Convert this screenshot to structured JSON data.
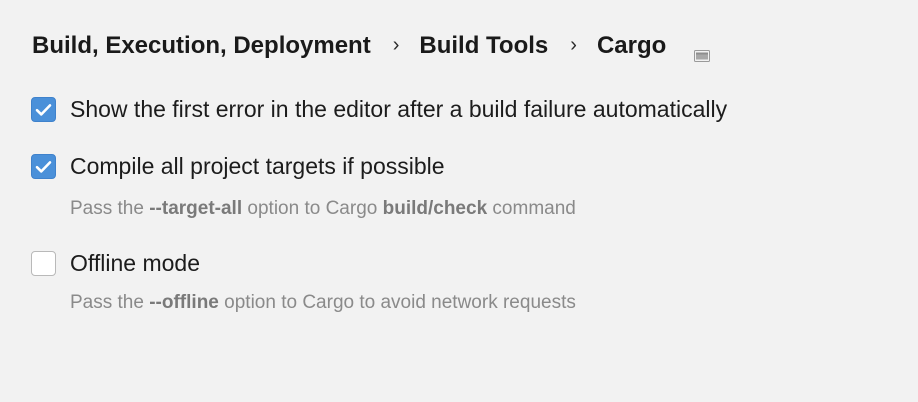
{
  "breadcrumb": {
    "items": [
      "Build, Execution, Deployment",
      "Build Tools",
      "Cargo"
    ],
    "separator": "›",
    "layout_icon": "layout-toggle-icon"
  },
  "options": [
    {
      "label": "Show the first error in the editor after a build failure automatically",
      "checked": true
    },
    {
      "label": "Compile all project targets if possible",
      "checked": true,
      "hint": {
        "prefix": "Pass the ",
        "flag": "--target-all",
        "middle": " option to Cargo ",
        "commands": "build/check",
        "suffix": " command"
      }
    },
    {
      "label": "Offline mode",
      "checked": false,
      "hint": {
        "prefix": "Pass the ",
        "flag": "--offline",
        "suffix": " option to Cargo to avoid network requests"
      }
    }
  ],
  "colors": {
    "background": "#f2f2f2",
    "checkbox_accent": "#4a90d9",
    "hint_text": "#8a8a8a"
  }
}
